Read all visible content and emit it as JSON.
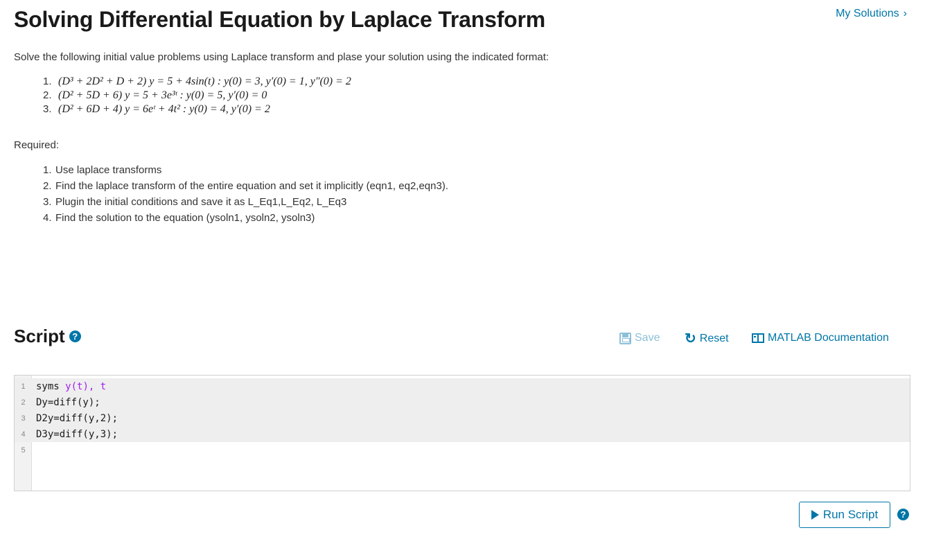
{
  "header": {
    "title": "Solving Differential Equation by Laplace Transform",
    "my_solutions": "My Solutions",
    "my_solutions_chevron": "›"
  },
  "problem": {
    "intro": "Solve the following initial value problems using Laplace transform and plase your solution using the indicated format:",
    "equations": [
      {
        "num": "1.",
        "text": "(D³ + 2D² + D + 2) y = 5 + 4sin(t) : y(0) = 3, y′(0) = 1, y″(0) = 2"
      },
      {
        "num": "2.",
        "text": "(D² + 5D + 6) y = 5 + 3e³ᵗ : y(0) = 5, y′(0) = 0"
      },
      {
        "num": "3.",
        "text": "(D² + 6D + 4) y = 6eᵗ + 4t² : y(0) = 4, y′(0) = 2"
      }
    ],
    "required_label": "Required:",
    "requirements": [
      {
        "num": "1.",
        "text": "Use laplace transforms"
      },
      {
        "num": "2.",
        "text": "Find the laplace transform of the entire equation and set it implicitly (eqn1, eq2,eqn3)."
      },
      {
        "num": "3.",
        "text": "Plugin the initial conditions and save it as L_Eq1,L_Eq2, L_Eq3"
      },
      {
        "num": "4.",
        "text": "Find the solution to the equation (ysoln1, ysoln2, ysoln3)"
      }
    ]
  },
  "script": {
    "heading": "Script",
    "help_glyph": "?",
    "toolbar": {
      "save": "Save",
      "reset": "Reset",
      "reset_glyph": "↻",
      "docs": "MATLAB Documentation"
    },
    "lines": [
      {
        "ln": "1",
        "pre": "syms ",
        "purple": "y(t), t",
        "post": ""
      },
      {
        "ln": "2",
        "pre": "Dy=diff(y);",
        "purple": "",
        "post": ""
      },
      {
        "ln": "3",
        "pre": "D2y=diff(y,2);",
        "purple": "",
        "post": ""
      },
      {
        "ln": "4",
        "pre": "D3y=diff(y,3);",
        "purple": "",
        "post": ""
      },
      {
        "ln": "5",
        "pre": "",
        "purple": "",
        "post": ""
      }
    ],
    "run_label": "Run Script"
  },
  "colors": {
    "accent": "#0076a8",
    "disabled": "#8cc0d8",
    "keyword_purple": "#a020f0"
  }
}
